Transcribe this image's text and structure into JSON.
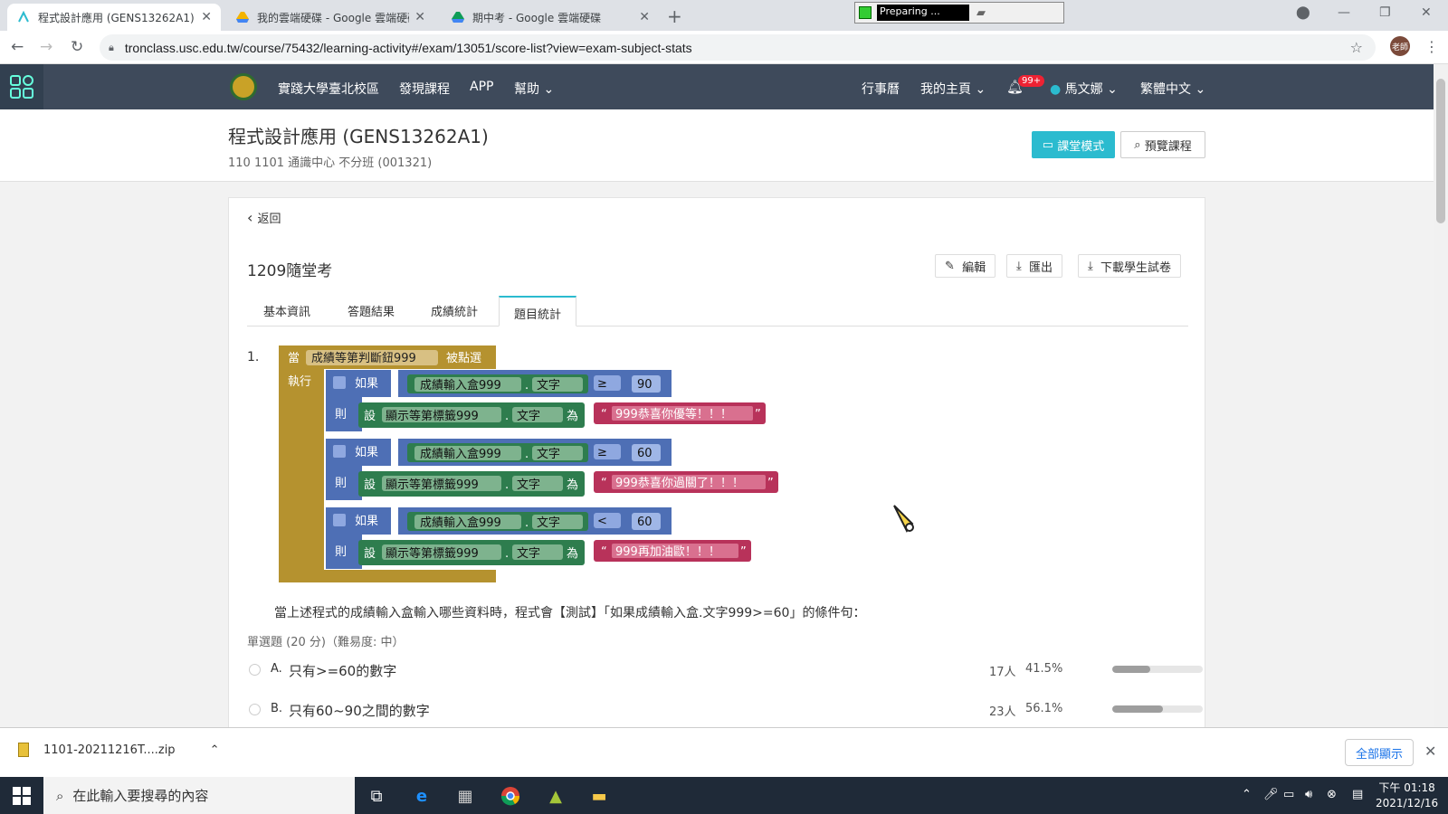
{
  "browser": {
    "tabs": [
      {
        "title": "程式設計應用 (GENS13262A1)",
        "icon": "tronclass-icon"
      },
      {
        "title": "我的雲端硬碟 - Google 雲端硬碟",
        "icon": "google-drive-icon"
      },
      {
        "title": "期中考 - Google 雲端硬碟",
        "icon": "google-drive-icon"
      }
    ],
    "url": "tronclass.usc.edu.tw/course/75432/learning-activity#/exam/13051/score-list?view=exam-subject-stats",
    "recorder_text": "Preparing ...",
    "profile": "老師"
  },
  "nav": {
    "school": "實踐大學臺北校區",
    "discover": "發現課程",
    "app": "APP",
    "help": "幫助",
    "calendar": "行事曆",
    "home": "我的主頁",
    "badge": "99+",
    "user": "馬文娜",
    "lang": "繁體中文"
  },
  "course": {
    "title": "程式設計應用 (GENS13262A1)",
    "subtitle": "110 1101 通識中心 不分班 (001321)",
    "class_mode": "課堂模式",
    "preview": "預覽課程"
  },
  "exam": {
    "back": "返回",
    "title": "1209隨堂考",
    "edit": "編輯",
    "export": "匯出",
    "download": "下載學生試卷",
    "tabs": [
      "基本資訊",
      "答題結果",
      "成績統計",
      "題目統計"
    ],
    "active_tab": "題目統計"
  },
  "question": {
    "number": "1.",
    "blocks": {
      "when": "當",
      "button": "成績等第判斷鈕999",
      "clicked": "被點選",
      "do": "執行",
      "if": "如果",
      "then": "則",
      "set": "設",
      "for": "為",
      "input_box": "成績輸入盒999",
      "text_prop": "文字",
      "label": "顯示等第標籤999",
      "dot": ".",
      "quote_open": "“",
      "quote_close": "”",
      "rules": [
        {
          "op": "≥",
          "value": "90",
          "message": "999恭喜你優等！！！"
        },
        {
          "op": "≥",
          "value": "60",
          "message": "999恭喜你過關了！！！"
        },
        {
          "op": "<",
          "value": "60",
          "message": "999再加油歐！！！"
        }
      ]
    },
    "text": "當上述程式的成績輸入盒輸入哪些資料時，程式會【測試】「如果成績輸入盒.文字999>=60」的條件句：",
    "meta": "單選題 (20 分)（難易度: 中）",
    "options": [
      {
        "letter": "A.",
        "text": "只有>=60的數字",
        "count": "17人",
        "percent": "41.5%",
        "ratio": 0.415
      },
      {
        "letter": "B.",
        "text": "只有60~90之間的數字",
        "count": "23人",
        "percent": "56.1%",
        "ratio": 0.561
      }
    ]
  },
  "download_bar": {
    "file": "1101-20211216T....zip",
    "show_all": "全部顯示"
  },
  "taskbar": {
    "search_placeholder": "在此輸入要搜尋的內容",
    "time": "下午 01:18",
    "date": "2021/12/16"
  },
  "colors": {
    "nav": "#3e4a5b",
    "accent": "#2bbbcf",
    "event_block": "#b5922f",
    "control_block": "#4e6fb5",
    "component_block": "#2e7d4e",
    "text_block": "#b8325a"
  }
}
